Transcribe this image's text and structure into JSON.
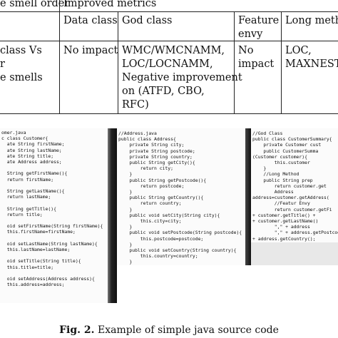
{
  "table": {
    "header_col1": "e smell order",
    "header_group": "Improved metrics",
    "subheaders": [
      "Data class",
      "God class",
      "Feature\nenvy",
      "Long meth"
    ],
    "row": {
      "col1": [
        "class    Vs",
        "r",
        "e smells"
      ],
      "data_class": "No impact",
      "god_class": [
        "WMC/WMCNAMM,",
        "LOC/LOCNAMM,",
        "Negative improvement",
        "on (ATFD, CBO,",
        "RFC)"
      ],
      "feature_envy": [
        "No",
        "impact"
      ],
      "long_method": [
        "LOC,",
        "MAXNEST"
      ]
    }
  },
  "code_panels": [
    {
      "lines": [
        "omer.java",
        "c class Customer{",
        "  ate String firstName;",
        "  ate String lastName;",
        "  ate String title;",
        "  ate Address address;",
        "",
        "  String getFirstName(){",
        "  return firstName;",
        "",
        "  String getLastName(){",
        "  return lastName;",
        "",
        "  String getTitle(){",
        "  return title;",
        "",
        "  oid setFirstName(String firstName){",
        "  this.firstName=firstName;",
        "",
        "  oid setLastName(String lastName){",
        "  this.lastName=lastName;",
        "",
        "  oid setTitle(String title){",
        "  this.title=title;",
        "",
        "  oid setAddress(Address address){",
        "  this.address=address;"
      ]
    },
    {
      "lines": [
        "//Address.java",
        "public class Address{",
        "    private String city;",
        "    private String postcode;",
        "    private String country;",
        "    public String getCity(){",
        "        return city;",
        "    }",
        "    public String getPostcode(){",
        "        return postcode;",
        "    }",
        "    public String getCountry(){",
        "        return country;",
        "    }",
        "    public void setCity(String city){",
        "        this.city=city;",
        "    }",
        "    public void setPostcode(String postcode){",
        "        this.postcode=postcode;",
        "    }",
        "    public void setCountry(String country){",
        "        this.country=country;",
        "    }",
        "}"
      ]
    },
    {
      "lines": [
        "//God Class",
        "public class CustomerSummary{",
        "    private Customer cust",
        "    public CustomerSumma",
        "(Customer customer){",
        "        this.customer",
        "    }",
        "    //Long Method",
        "    public String prep",
        "        return customer.get",
        "        Address",
        "address=customer.getAddress(",
        "        //Featur Envy",
        "        return customer.getFi",
        "+ customer.getTitle() +",
        "+ customer.getLastName()",
        "        \",\" + address",
        "        \",\" + address.getPostcode() +",
        "+ address.getCountry();",
        "    }",
        "}"
      ]
    }
  ],
  "caption": {
    "label": "Fig. 2.",
    "text": " Example of simple java source code"
  }
}
